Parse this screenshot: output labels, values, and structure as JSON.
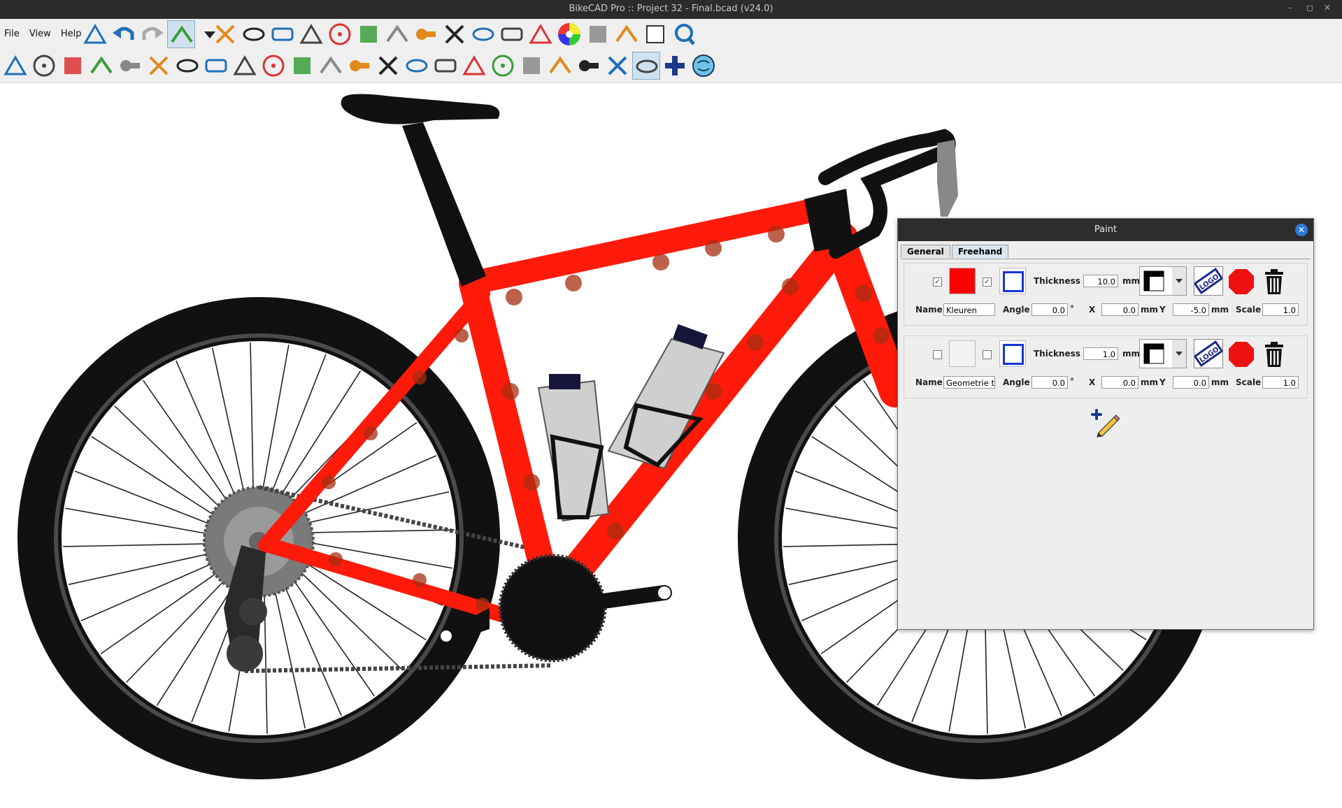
{
  "window": {
    "title": "BikeCAD Pro :: Project 32 - Final.bcad (v24.0)",
    "min_glyph": "–",
    "max_glyph": "◻",
    "close_glyph": "✕"
  },
  "menu": {
    "file": "File",
    "view": "View",
    "help": "Help"
  },
  "paint_dialog": {
    "title": "Paint",
    "close_glyph": "✕",
    "tabs": [
      {
        "label": "General"
      },
      {
        "label": "Freehand"
      }
    ],
    "active_tab": "Freehand",
    "layers": [
      {
        "fill_enabled": true,
        "fill_color": "#ff0000",
        "outline_enabled": true,
        "outline_color": "#1536d8",
        "thickness_label": "Thickness",
        "thickness": "10.0",
        "thickness_unit": "mm",
        "name_label": "Name",
        "name": "Kleuren",
        "angle_label": "Angle",
        "angle": "0.0",
        "angle_unit": "°",
        "x_label": "X",
        "x": "0.0",
        "x_unit": "mm",
        "y_label": "Y",
        "y": "-5.0",
        "y_unit": "mm",
        "scale_label": "Scale",
        "scale": "1.0"
      },
      {
        "fill_enabled": false,
        "fill_color": "#f2f2f2",
        "outline_enabled": false,
        "outline_color": "#1536d8",
        "thickness_label": "Thickness",
        "thickness": "1.0",
        "thickness_unit": "mm",
        "name_label": "Name",
        "name": "Geometrie t",
        "angle_label": "Angle",
        "angle": "0.0",
        "angle_unit": "°",
        "x_label": "X",
        "x": "0.0",
        "x_unit": "mm",
        "y_label": "Y",
        "y": "0.0",
        "y_unit": "mm",
        "scale_label": "Scale",
        "scale": "1.0"
      }
    ],
    "logo_text": "LOGO"
  },
  "colors": {
    "frame": "#ff1a0a",
    "tire": "#111111",
    "bottle": "#cfcfcf",
    "titlebar": "#2b2b2b"
  },
  "icons": {
    "row1": [
      "tables-icon",
      "undo-icon",
      "redo-icon",
      "background-icon",
      "dropdown-icon",
      "dimensions-icon",
      "compare-icon",
      "lock-icon",
      "texture-icon",
      "paint-icon",
      "caliper-icon",
      "notes-icon",
      "flag-icon",
      "visibility-icon",
      "measure-icon",
      "note-icon",
      "rider-icon",
      "color-wheel-icon",
      "chainring-icon",
      "block-icon",
      "blank-icon",
      "zoom-icon"
    ],
    "row2": [
      "frame-icon",
      "wheel-icon",
      "fork-icon",
      "saddle-icon",
      "seatpost-icon",
      "headset-icon",
      "stem-icon",
      "handlebar-icon",
      "aero-bar-icon",
      "tube-icon",
      "frame-blue-icon",
      "frame-red-icon",
      "bottle-icon",
      "drivetrain-icon",
      "seatstay-icon",
      "brake-icon",
      "crankset-icon",
      "derailleur-icon",
      "fender-icon",
      "shoe-icon",
      "pedal-icon",
      "tire-icon",
      "rack-icon",
      "add-icon",
      "brain-icon"
    ]
  }
}
